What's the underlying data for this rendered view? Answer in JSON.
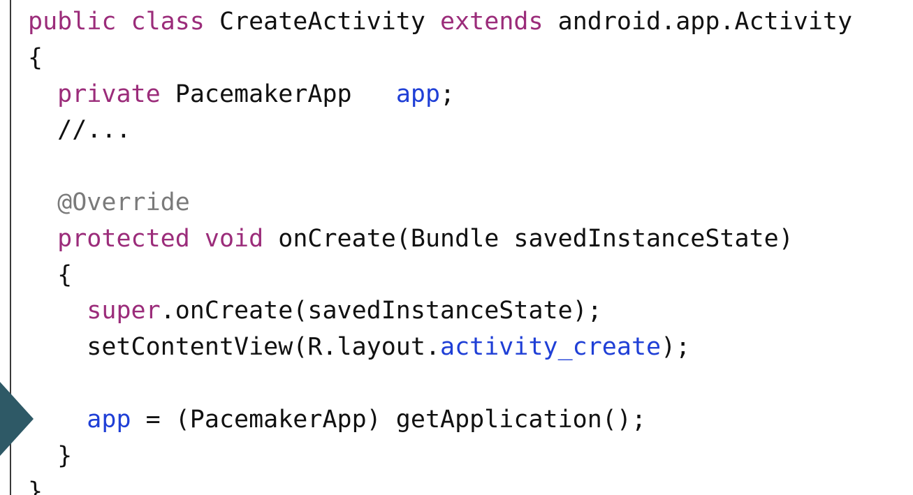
{
  "colors": {
    "keyword": "#9b2c7a",
    "identifier": "#1f3fd6",
    "annotation": "#7a7a7a",
    "plain": "#111111",
    "marker": "#2e5966"
  },
  "marker_icon": "arrow-right-icon",
  "code": {
    "lines": [
      [
        {
          "t": "public",
          "k": "kw"
        },
        {
          "t": " ",
          "k": "pl"
        },
        {
          "t": "class",
          "k": "kw"
        },
        {
          "t": " CreateActivity ",
          "k": "pl"
        },
        {
          "t": "extends",
          "k": "kw"
        },
        {
          "t": " android.app.Activity",
          "k": "pl"
        }
      ],
      [
        {
          "t": "{",
          "k": "pl"
        }
      ],
      [
        {
          "t": "  ",
          "k": "pl"
        },
        {
          "t": "private",
          "k": "kw"
        },
        {
          "t": " PacemakerApp   ",
          "k": "pl"
        },
        {
          "t": "app",
          "k": "id"
        },
        {
          "t": ";",
          "k": "pl"
        }
      ],
      [
        {
          "t": "  //...",
          "k": "pl"
        }
      ],
      [],
      [
        {
          "t": "  ",
          "k": "pl"
        },
        {
          "t": "@Override",
          "k": "an"
        }
      ],
      [
        {
          "t": "  ",
          "k": "pl"
        },
        {
          "t": "protected",
          "k": "kw"
        },
        {
          "t": " ",
          "k": "pl"
        },
        {
          "t": "void",
          "k": "kw"
        },
        {
          "t": " onCreate(Bundle savedInstanceState)",
          "k": "pl"
        }
      ],
      [
        {
          "t": "  {",
          "k": "pl"
        }
      ],
      [
        {
          "t": "    ",
          "k": "pl"
        },
        {
          "t": "super",
          "k": "kw"
        },
        {
          "t": ".onCreate(savedInstanceState);",
          "k": "pl"
        }
      ],
      [
        {
          "t": "    setContentView(R.layout.",
          "k": "pl"
        },
        {
          "t": "activity_create",
          "k": "id"
        },
        {
          "t": ");",
          "k": "pl"
        }
      ],
      [],
      [
        {
          "t": "    ",
          "k": "pl"
        },
        {
          "t": "app",
          "k": "id"
        },
        {
          "t": " = (PacemakerApp) getApplication();",
          "k": "pl"
        }
      ],
      [
        {
          "t": "  }",
          "k": "pl"
        }
      ],
      [
        {
          "t": "}",
          "k": "pl"
        }
      ]
    ]
  }
}
